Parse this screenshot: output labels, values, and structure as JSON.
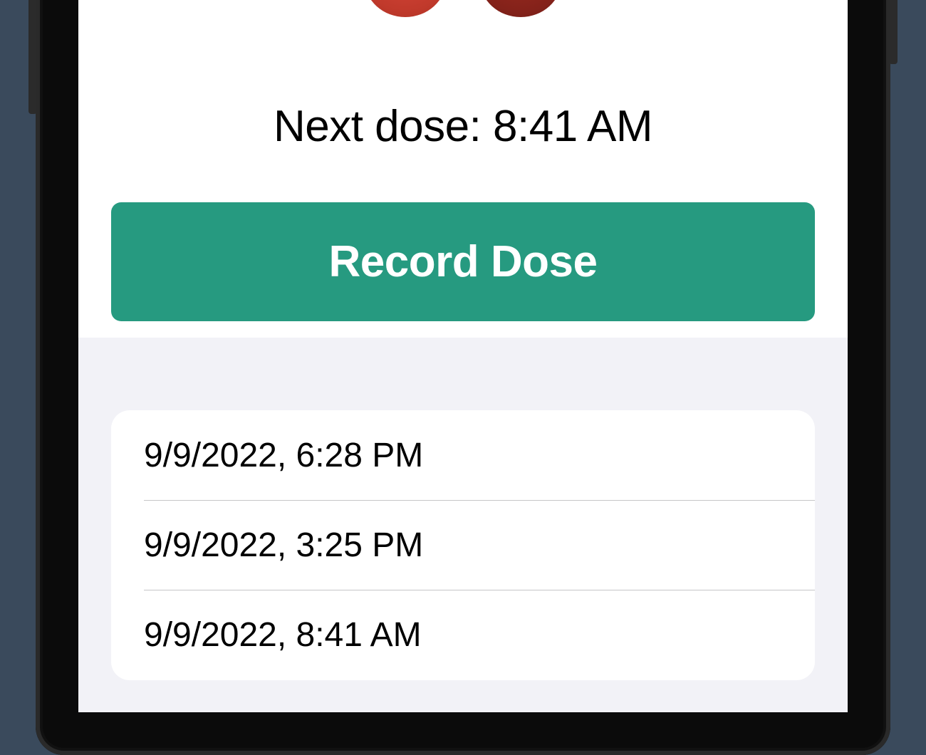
{
  "next_dose": {
    "label": "Next dose: 8:41 AM"
  },
  "record_button": {
    "label": "Record Dose",
    "color": "#269a80"
  },
  "dose_history": [
    "9/9/2022, 6:28 PM",
    "9/9/2022, 3:25 PM",
    "9/9/2022, 8:41 AM"
  ],
  "colors": {
    "background": "#3a4a5c",
    "screen_top": "#ffffff",
    "screen_bottom": "#f2f2f7",
    "pill_left": "#c0392b",
    "pill_right": "#84221a"
  },
  "icons": {
    "pill_left": "pill-half-icon",
    "pill_right": "pill-half-icon"
  }
}
